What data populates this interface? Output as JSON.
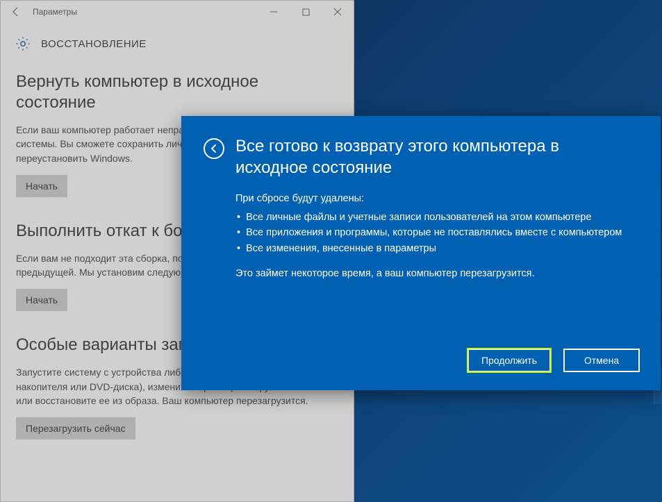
{
  "settings": {
    "window_title": "Параметры",
    "page_title": "ВОССТАНОВЛЕНИЕ",
    "sections": {
      "reset": {
        "heading": "Вернуть компьютер в исходное состояние",
        "body": "Если ваш компьютер работает неправильно, может помочь сброс системы. Вы сможете сохранить личные файлы и затем переустановить Windows.",
        "button": "Начать"
      },
      "rollback": {
        "heading": "Выполнить откат к более ранней сборке",
        "body": "Если вам не подходит эта сборка, попробуйте откатиться к предыдущей. Мы установим следующую сборку по мере готовности.",
        "button": "Начать"
      },
      "advanced": {
        "heading": "Особые варианты загрузки",
        "body": "Запустите систему с устройства либо диска (например, USB-накопителя или DVD-диска), измените параметры загрузки Windows или восстановите ее из образа. Ваш компьютер перезагрузится.",
        "button": "Перезагрузить сейчас"
      }
    }
  },
  "modal": {
    "title": "Все готово к возврату этого компьютера в исходное состояние",
    "lead": "При сбросе будут удалены:",
    "bullets": [
      "Все личные файлы и учетные записи пользователей на этом компьютере",
      "Все приложения и программы, которые не поставлялись вместе с компьютером",
      "Все изменения, внесенные в параметры"
    ],
    "note": "Это займет некоторое время, а ваш компьютер перезагрузится.",
    "continue": "Продолжить",
    "cancel": "Отмена"
  }
}
